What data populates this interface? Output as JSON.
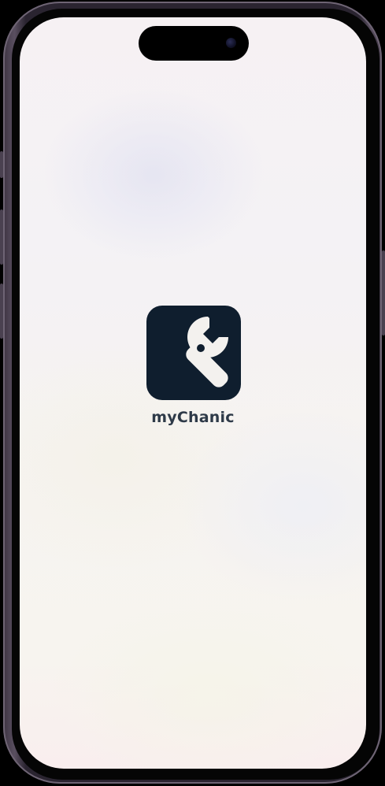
{
  "app": {
    "name": "myChanic",
    "icon": "wrench-icon",
    "icon_background": "#0f1e2e",
    "icon_foreground": "#f3f1ee"
  },
  "colors": {
    "screen_background": "#f6f3f2",
    "app_name_text": "#2e3a48",
    "device_frame": "#2a2430"
  }
}
